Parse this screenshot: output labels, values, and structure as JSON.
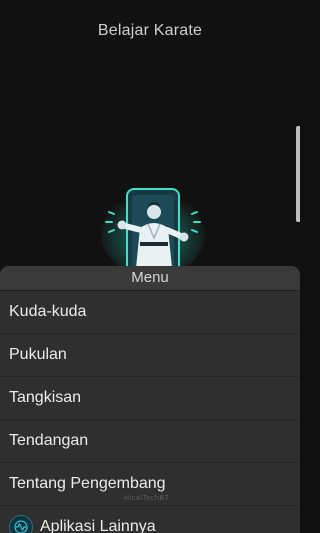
{
  "app": {
    "title": "Belajar Karate"
  },
  "logo": {
    "icon": "karate-phone-logo"
  },
  "menu": {
    "title": "Menu",
    "items": [
      {
        "label": "Kuda-kuda"
      },
      {
        "label": "Pukulan"
      },
      {
        "label": "Tangkisan"
      },
      {
        "label": "Tendangan"
      },
      {
        "label": "Tentang Pengembang"
      },
      {
        "label": "Aplikasi Lainnya",
        "icon": "apps-icon"
      }
    ],
    "watermark": "HicalTech87"
  },
  "colors": {
    "background": "#111111",
    "sheet": "#303030",
    "accent": "#2fd3b8"
  }
}
